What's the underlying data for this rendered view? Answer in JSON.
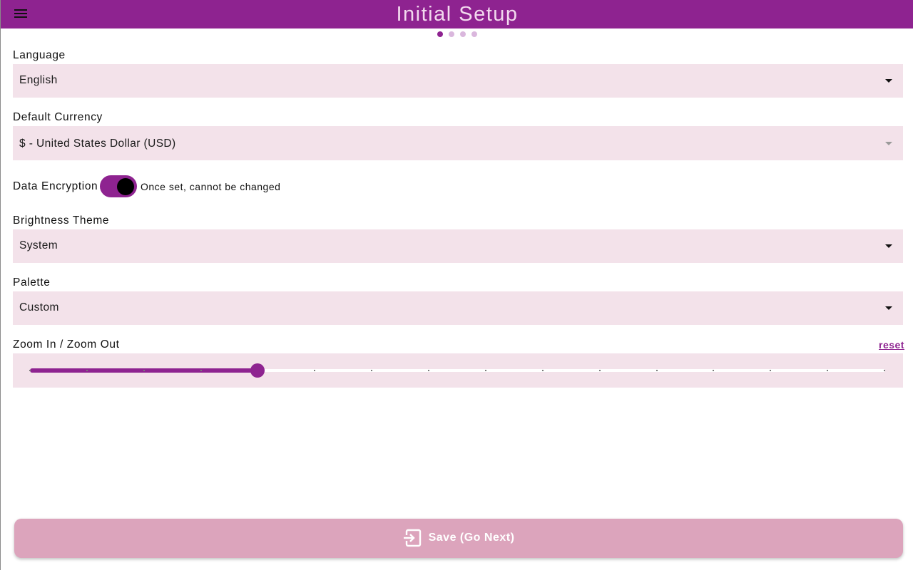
{
  "header": {
    "title": "Initial Setup",
    "menu_icon": "menu-icon",
    "background": "#8e2390"
  },
  "pager": {
    "total": 4,
    "current": 1
  },
  "form": {
    "language": {
      "label": "Language",
      "value": "English"
    },
    "currency": {
      "label": "Default Currency",
      "value": "$ - United States Dollar (USD)"
    },
    "encryption": {
      "label": "Data Encryption",
      "enabled": true,
      "note": "Once set, cannot be changed"
    },
    "theme": {
      "label": "Brightness Theme",
      "value": "System"
    },
    "palette": {
      "label": "Palette",
      "value": "Custom"
    },
    "zoom": {
      "label": "Zoom In / Zoom Out",
      "reset_label": "reset",
      "steps": 16,
      "value_step": 4
    }
  },
  "footer": {
    "save_label": "Save (Go Next)",
    "save_icon": "exit-icon"
  },
  "colors": {
    "accent": "#8e2390",
    "field_bg": "#f3e2ea",
    "button_bg": "#dca4bc"
  }
}
